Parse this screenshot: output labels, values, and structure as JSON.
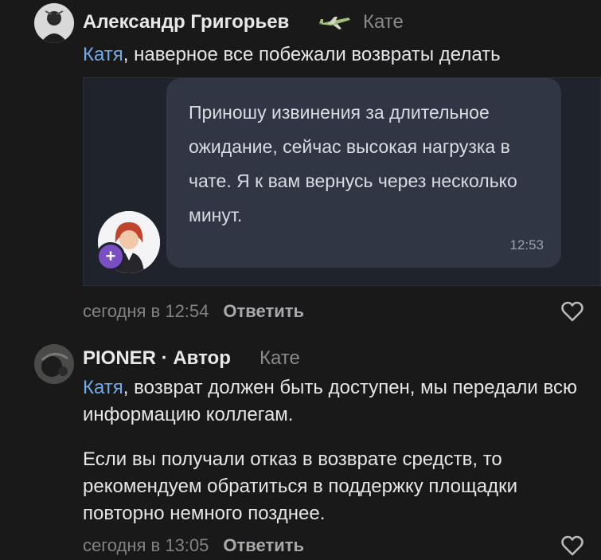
{
  "comments": [
    {
      "author": "Александр Григорьев",
      "author_badge_icon": "plane-icon",
      "reply_to": "Кате",
      "mention": "Катя",
      "text": ", наверное все побежали возвраты делать",
      "attachment": {
        "message": "Приношу извинения за длительное ожидание, сейчас высокая нагрузка в чате. Я к вам вернусь через несколько минут.",
        "time": "12:53",
        "avatar_badge": "+"
      },
      "timestamp": "сегодня в 12:54",
      "reply_label": "Ответить"
    },
    {
      "author": "PIONER · Автор",
      "reply_to": "Кате",
      "mention": "Катя",
      "text": ", возврат должен быть доступен, мы передали всю информацию коллегам.",
      "text2": "Если вы получали отказ в возврате средств, то рекомендуем обратиться в поддержку площадки повторно немного позднее.",
      "timestamp": "сегодня в 13:05",
      "reply_label": "Ответить"
    }
  ],
  "colors": {
    "background": "#19191a",
    "mention": "#71aaeb",
    "bubble": "#303644",
    "badge": "#7a4fc4"
  }
}
